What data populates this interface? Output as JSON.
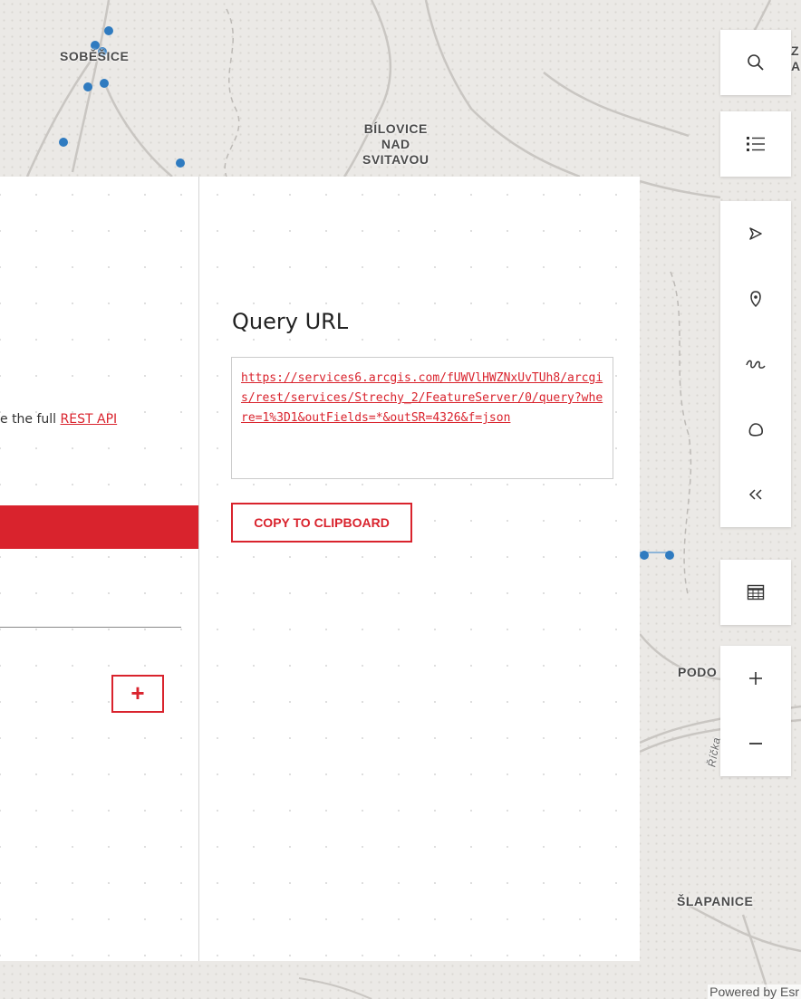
{
  "map": {
    "labels": {
      "sobesice": "SOBĚŠICE",
      "bilovice": "BÍLOVICE\nNAD\nSVITAVOU",
      "podoli": "PODO",
      "slapanice": "ŠLAPANICE",
      "ricka": "Říčka",
      "z_partial": "Z\nA"
    },
    "attribution": "Powered by Esr"
  },
  "panel": {
    "hint_prefix": "e the full ",
    "hint_link": "REST API",
    "add_button": "+",
    "query": {
      "title": "Query URL",
      "url": "https://services6.arcgis.com/fUWVlHWZNxUvTUh8/arcgis/rest/services/Strechy_2/FeatureServer/0/query?where=1%3D1&outFields=*&outSR=4326&f=json",
      "copy_button": "COPY TO CLIPBOARD"
    }
  },
  "toolbar": {
    "search": "search-icon",
    "layers": "layer-list-icon",
    "select": "select-arrow-icon",
    "point": "draw-point-icon",
    "line": "draw-line-icon",
    "polygon": "draw-polygon-icon",
    "collapse": "collapse-icon",
    "table": "table-icon",
    "zoom_in": "zoom-in-icon",
    "zoom_out": "zoom-out-icon"
  },
  "colors": {
    "accent": "#d9232d",
    "map_point": "#2f7bc0"
  }
}
